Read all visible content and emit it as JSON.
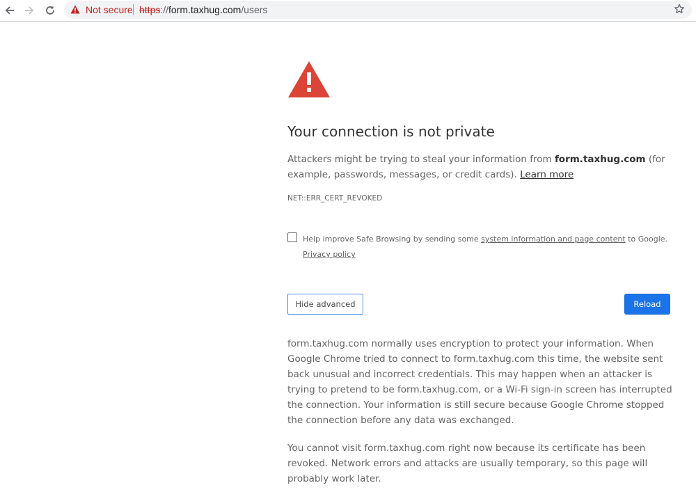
{
  "browser": {
    "security_label": "Not secure",
    "url": {
      "scheme": "https",
      "separator": "://",
      "host": "form.taxhug.com",
      "path": "/users"
    },
    "icons": {
      "back": "back-arrow-icon",
      "forward": "forward-arrow-icon",
      "reload": "reload-icon",
      "warning": "warning-triangle-icon",
      "bookmark": "star-icon"
    },
    "colors": {
      "not_secure": "#c5221f",
      "omnibox_bg": "#f1f3f4"
    }
  },
  "interstitial": {
    "icon": "red-warning-triangle-icon",
    "icon_color": "#db4437",
    "title": "Your connection is not private",
    "desc_pre": "Attackers might be trying to steal your information from ",
    "desc_host": "form.taxhug.com",
    "desc_post": " (for example, passwords, messages, or credit cards). ",
    "learn_more": "Learn more",
    "error_code": "NET::ERR_CERT_REVOKED",
    "optin_pre": "Help improve Safe Browsing by sending some ",
    "optin_link": "system information and page content",
    "optin_post": " to Google.",
    "privacy_policy": "Privacy policy",
    "optin_checked": false,
    "hide_advanced": "Hide advanced",
    "reload": "Reload",
    "reload_color": "#1a73e8",
    "details_1": "form.taxhug.com normally uses encryption to protect your information. When Google Chrome tried to connect to form.taxhug.com this time, the website sent back unusual and incorrect credentials. This may happen when an attacker is trying to pretend to be form.taxhug.com, or a Wi-Fi sign-in screen has interrupted the connection. Your information is still secure because Google Chrome stopped the connection before any data was exchanged.",
    "details_2": "You cannot visit form.taxhug.com right now because its certificate has been revoked. Network errors and attacks are usually temporary, so this page will probably work later."
  }
}
